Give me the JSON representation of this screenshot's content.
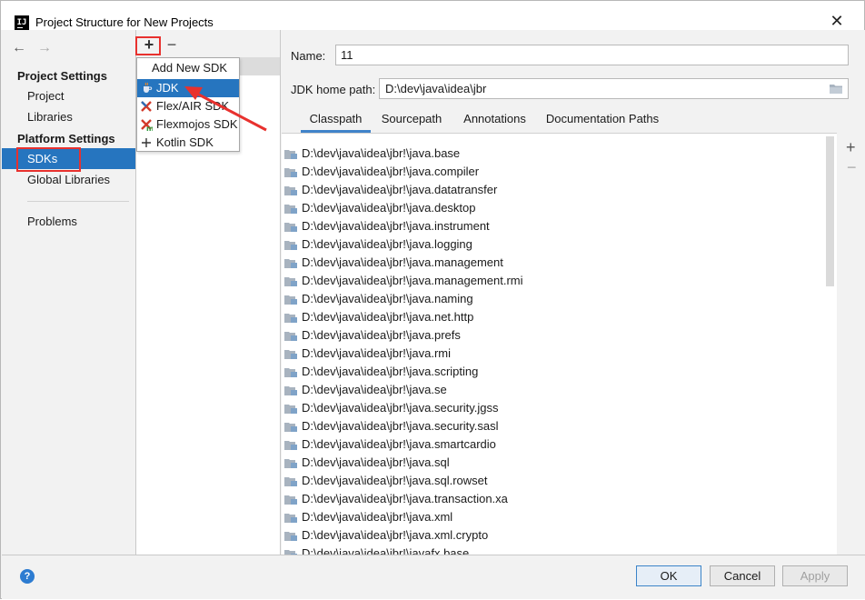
{
  "window": {
    "title": "Project Structure for New Projects",
    "app_icon_text": "IJ",
    "close_symbol": "✕"
  },
  "nav": {
    "back_symbol": "←",
    "forward_symbol": "→",
    "groups": [
      {
        "title": "Project Settings",
        "items": [
          "Project",
          "Libraries"
        ]
      },
      {
        "title": "Platform Settings",
        "items": [
          "SDKs",
          "Global Libraries"
        ]
      }
    ],
    "extra_items": [
      "Problems"
    ],
    "selected": "SDKs"
  },
  "sdk_toolbar": {
    "add_symbol": "+",
    "remove_symbol": "−"
  },
  "popup": {
    "header": "Add New SDK",
    "items": [
      {
        "label": "JDK",
        "icon": "jdk-cup-icon",
        "highlighted": true
      },
      {
        "label": "Flex/AIR SDK",
        "icon": "flex-air-icon",
        "highlighted": false
      },
      {
        "label": "Flexmojos SDK",
        "icon": "flexmojos-icon",
        "highlighted": false
      },
      {
        "label": "Kotlin SDK",
        "icon": "plus-icon",
        "highlighted": false
      }
    ]
  },
  "details": {
    "name_label": "Name:",
    "name_value": "11",
    "home_label": "JDK home path:",
    "home_value": "D:\\dev\\java\\idea\\jbr",
    "tabs": [
      "Classpath",
      "Sourcepath",
      "Annotations",
      "Documentation Paths"
    ],
    "active_tab": "Classpath",
    "classpath": [
      "D:\\dev\\java\\idea\\jbr!\\java.base",
      "D:\\dev\\java\\idea\\jbr!\\java.compiler",
      "D:\\dev\\java\\idea\\jbr!\\java.datatransfer",
      "D:\\dev\\java\\idea\\jbr!\\java.desktop",
      "D:\\dev\\java\\idea\\jbr!\\java.instrument",
      "D:\\dev\\java\\idea\\jbr!\\java.logging",
      "D:\\dev\\java\\idea\\jbr!\\java.management",
      "D:\\dev\\java\\idea\\jbr!\\java.management.rmi",
      "D:\\dev\\java\\idea\\jbr!\\java.naming",
      "D:\\dev\\java\\idea\\jbr!\\java.net.http",
      "D:\\dev\\java\\idea\\jbr!\\java.prefs",
      "D:\\dev\\java\\idea\\jbr!\\java.rmi",
      "D:\\dev\\java\\idea\\jbr!\\java.scripting",
      "D:\\dev\\java\\idea\\jbr!\\java.se",
      "D:\\dev\\java\\idea\\jbr!\\java.security.jgss",
      "D:\\dev\\java\\idea\\jbr!\\java.security.sasl",
      "D:\\dev\\java\\idea\\jbr!\\java.smartcardio",
      "D:\\dev\\java\\idea\\jbr!\\java.sql",
      "D:\\dev\\java\\idea\\jbr!\\java.sql.rowset",
      "D:\\dev\\java\\idea\\jbr!\\java.transaction.xa",
      "D:\\dev\\java\\idea\\jbr!\\java.xml",
      "D:\\dev\\java\\idea\\jbr!\\java.xml.crypto",
      "D:\\dev\\java\\idea\\jbr!\\javafx.base"
    ],
    "side_add_symbol": "+",
    "side_remove_symbol": "−"
  },
  "buttons": {
    "help": "?",
    "ok": "OK",
    "cancel": "Cancel",
    "apply": "Apply"
  },
  "colors": {
    "selection": "#2675bf",
    "annotation_red": "#e8312e",
    "help_blue": "#2d7cd1"
  }
}
